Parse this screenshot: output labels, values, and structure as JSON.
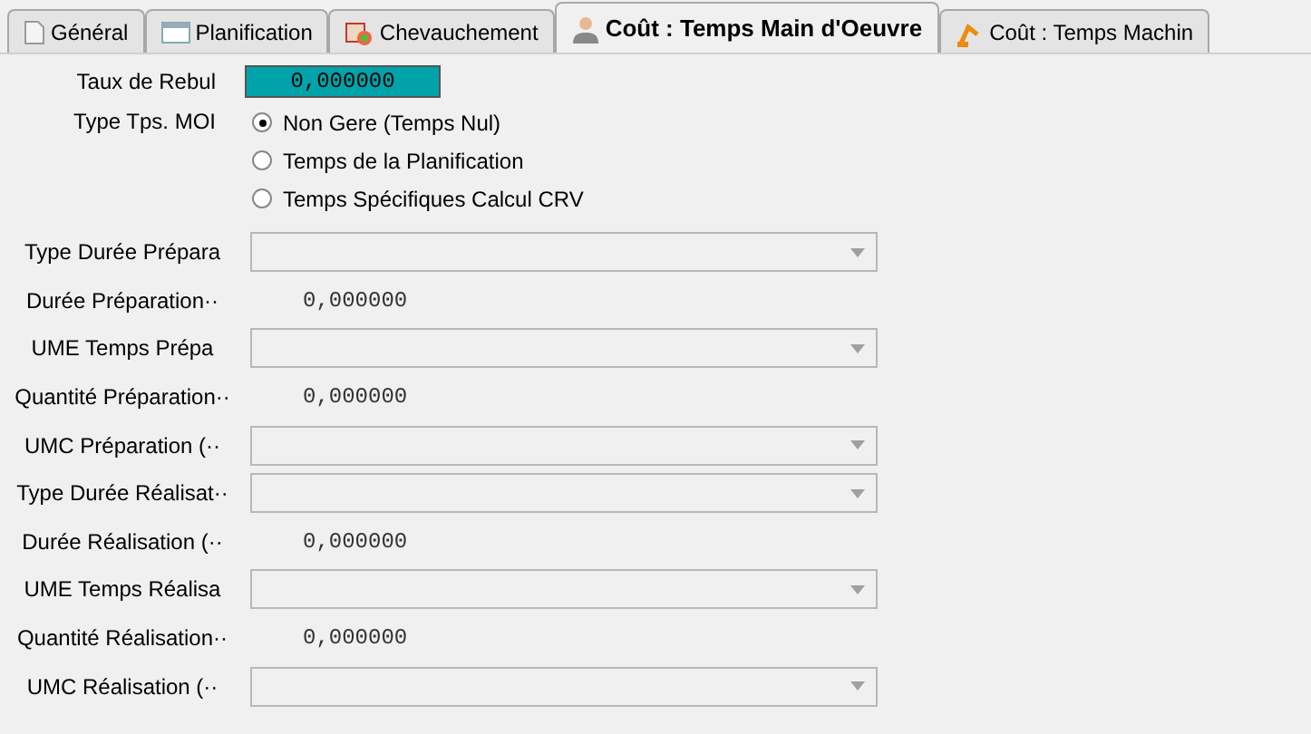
{
  "tabs": [
    {
      "label": "Général",
      "selected": false,
      "kind": "document"
    },
    {
      "label": "Planification",
      "selected": false,
      "kind": "calendar"
    },
    {
      "label": "Chevauchement",
      "selected": false,
      "kind": "cards"
    },
    {
      "label": "Coût : Temps Main d'Oeuvre",
      "selected": true,
      "kind": "person"
    },
    {
      "label": "Coût : Temps Machin",
      "selected": false,
      "kind": "robot"
    }
  ],
  "scrap_rate": {
    "label": "Taux de Rebul",
    "value": "0,000000"
  },
  "labor_time_type": {
    "label": "Type Tps. MOI",
    "options": [
      {
        "label": "Non Gere (Temps Nul)",
        "selected": true
      },
      {
        "label": "Temps de la Planification",
        "selected": false
      },
      {
        "label": "Temps Spécifiques Calcul CRV",
        "selected": false
      }
    ]
  },
  "fields": [
    {
      "label": "Type Durée Prépara",
      "kind": "dropdown"
    },
    {
      "label": "Durée Préparation··",
      "kind": "number",
      "value": "0,000000"
    },
    {
      "label": "UME Temps Prépa",
      "kind": "dropdown"
    },
    {
      "label": "Quantité Préparation··",
      "kind": "number",
      "value": "0,000000"
    },
    {
      "label": "UMC Préparation (··",
      "kind": "dropdown"
    },
    {
      "label": "Type Durée Réalisat··",
      "kind": "dropdown"
    },
    {
      "label": "Durée Réalisation (··",
      "kind": "number",
      "value": "0,000000"
    },
    {
      "label": "UME Temps Réalisa",
      "kind": "dropdown"
    },
    {
      "label": "Quantité Réalisation··",
      "kind": "number",
      "value": "0,000000"
    },
    {
      "label": "UMC Réalisation (··",
      "kind": "dropdown"
    }
  ]
}
